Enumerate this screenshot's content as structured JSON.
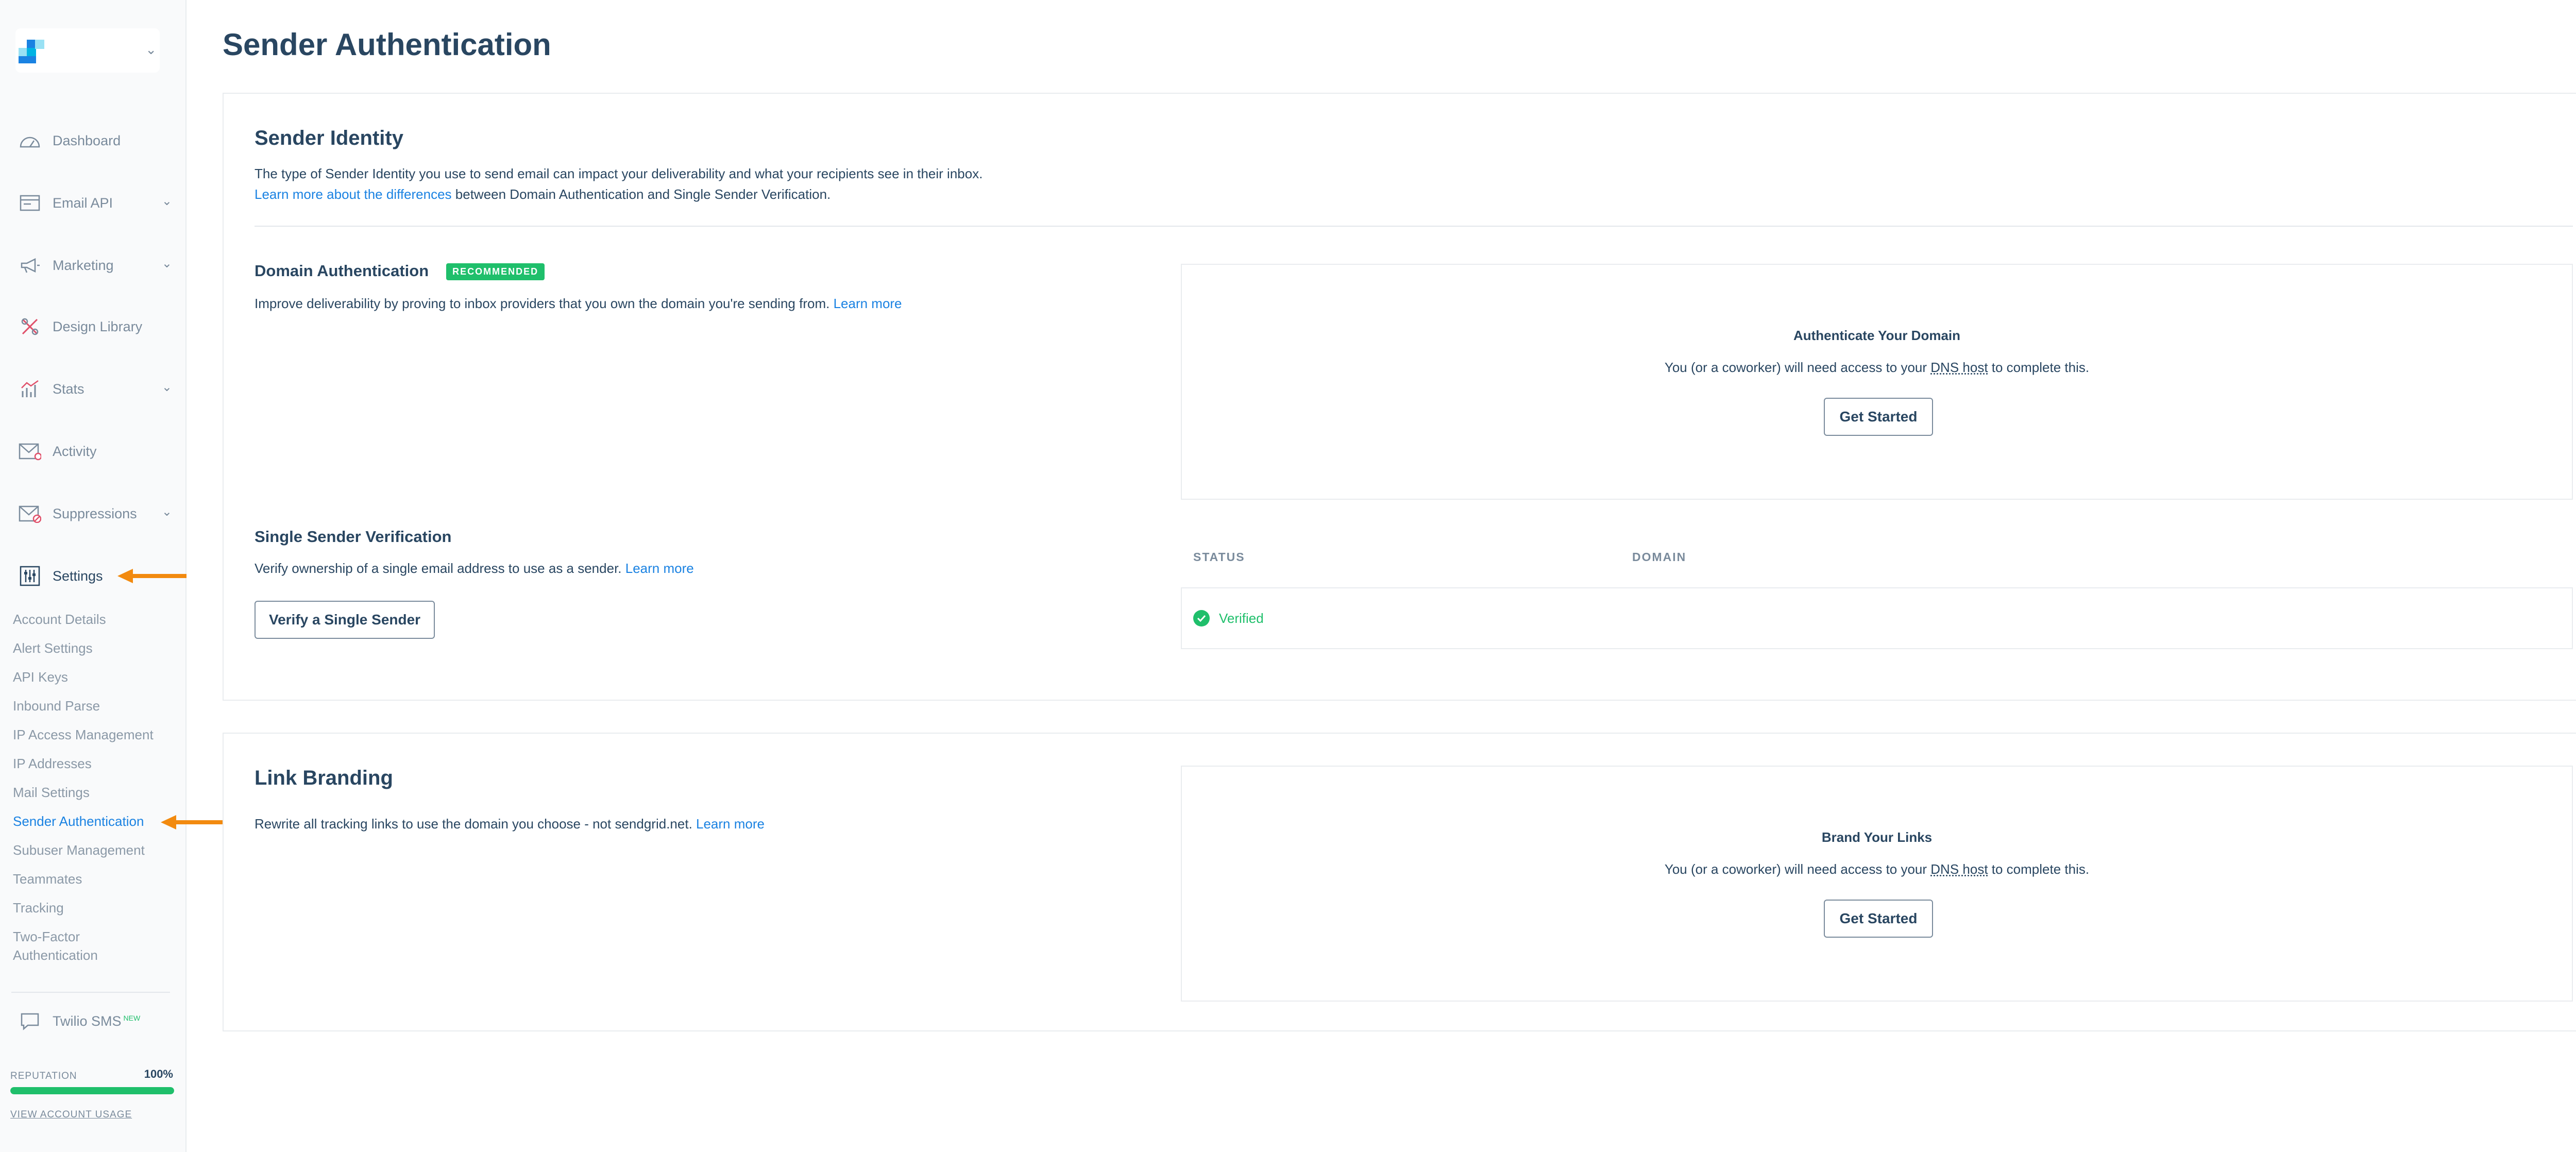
{
  "sidebar": {
    "nav": [
      {
        "label": "Dashboard",
        "icon": "dashboard-icon",
        "chevron": false
      },
      {
        "label": "Email API",
        "icon": "email-api-icon",
        "chevron": true
      },
      {
        "label": "Marketing",
        "icon": "megaphone-icon",
        "chevron": true
      },
      {
        "label": "Design Library",
        "icon": "design-library-icon",
        "chevron": false
      },
      {
        "label": "Stats",
        "icon": "stats-icon",
        "chevron": true
      },
      {
        "label": "Activity",
        "icon": "activity-icon",
        "chevron": false
      },
      {
        "label": "Suppressions",
        "icon": "suppressions-icon",
        "chevron": true
      },
      {
        "label": "Settings",
        "icon": "settings-icon",
        "chevron": false
      }
    ],
    "settings_items": [
      "Account Details",
      "Alert Settings",
      "API Keys",
      "Inbound Parse",
      "IP Access Management",
      "IP Addresses",
      "Mail Settings",
      "Sender Authentication",
      "Subuser Management",
      "Teammates",
      "Tracking",
      "Two-Factor Authentication"
    ],
    "active_item": "Sender Authentication",
    "twilio_sms": {
      "label": "Twilio SMS",
      "badge": "NEW"
    },
    "reputation": {
      "label": "REPUTATION",
      "value": "100%",
      "fraction": 1.0
    },
    "usage_link": "VIEW ACCOUNT USAGE"
  },
  "page": {
    "title": "Sender Authentication"
  },
  "sender_identity": {
    "title": "Sender Identity",
    "description": "The type of Sender Identity you use to send email can impact your deliverability and what your recipients see in their inbox.",
    "learn_link": "Learn more about the differences",
    "learn_suffix": " between Domain Authentication and Single Sender Verification."
  },
  "domain_auth": {
    "title": "Domain Authentication",
    "badge": "RECOMMENDED",
    "description": "Improve deliverability by proving to inbox providers that you own the domain you're sending from. ",
    "learn_more": "Learn more",
    "box_title": "Authenticate Your Domain",
    "box_text_pre": "You (or a coworker) will need access to your ",
    "box_text_dns": "DNS host",
    "box_text_post": " to complete this.",
    "button": "Get Started"
  },
  "single_sender": {
    "title": "Single Sender Verification",
    "description": "Verify ownership of a single email address to use as a sender. ",
    "learn_more": "Learn more",
    "button": "Verify a Single Sender",
    "columns": [
      "STATUS",
      "DOMAIN"
    ],
    "status": "Verified"
  },
  "link_branding": {
    "title": "Link Branding",
    "description": "Rewrite all tracking links to use the domain you choose - not sendgrid.net. ",
    "learn_more": "Learn more",
    "box_title": "Brand Your Links",
    "box_text_pre": "You (or a coworker) will need access to your ",
    "box_text_dns": "DNS host",
    "box_text_post": " to complete this.",
    "button": "Get Started"
  },
  "colors": {
    "primary_text": "#294661",
    "link": "#1a82e2",
    "success": "#1fbf6b",
    "arrow": "#f28a0f",
    "muted": "#7a8b9c"
  }
}
